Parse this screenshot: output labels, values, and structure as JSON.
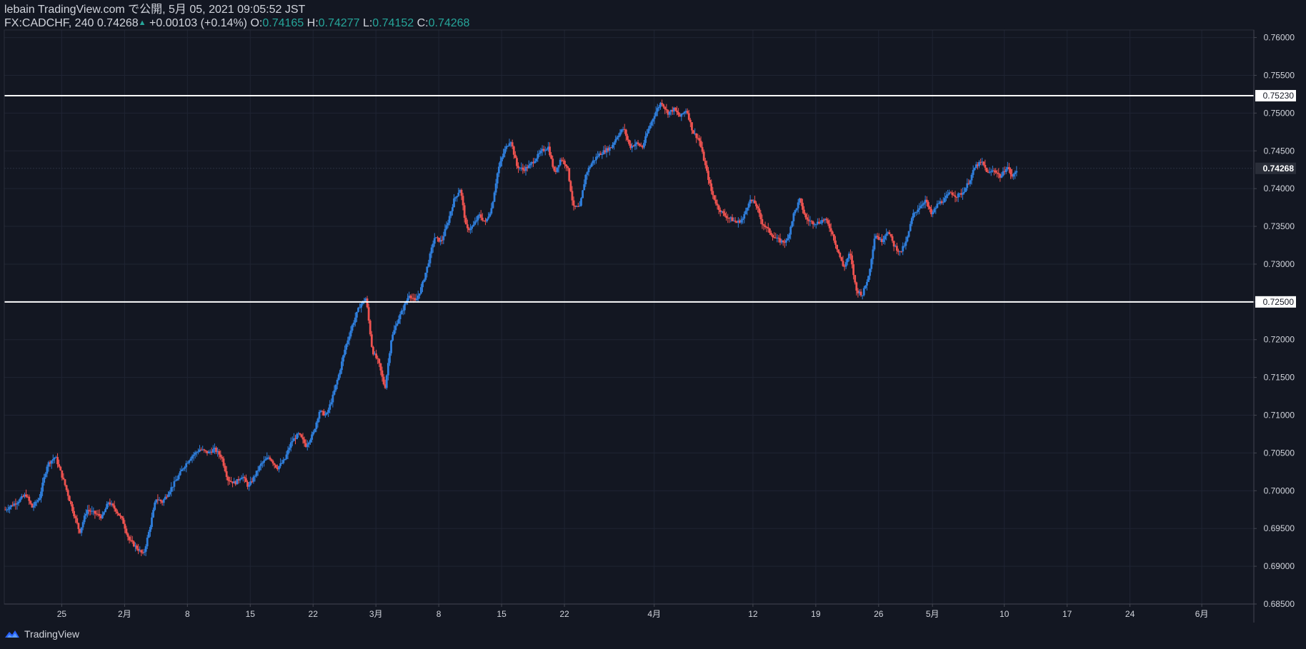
{
  "header": {
    "line1": "lebain TradingView.com で公開, 5月 05, 2021 09:05:52 JST",
    "symbol": "FX:CADCHF, 240",
    "last": "0.74268",
    "change": "+0.00103 (+0.14%)",
    "o_label": "O:",
    "o_value": "0.74165",
    "h_label": "H:",
    "h_value": "0.74277",
    "l_label": "L:",
    "l_value": "0.74152",
    "c_label": "C:",
    "c_value": "0.74268"
  },
  "footer": {
    "brand": "TradingView"
  },
  "colors": {
    "background": "#131722",
    "up": "#2f7fdd",
    "down": "#ef5350",
    "line": "#ffffff",
    "grid": "#1f2433",
    "text": "#d1d4dc"
  },
  "chart_data": {
    "type": "candlestick",
    "title": "",
    "y_axis": {
      "min": 0.685,
      "max": 0.761,
      "ticks": [
        "0.76000",
        "0.75500",
        "0.75000",
        "0.74500",
        "0.74000",
        "0.73500",
        "0.73000",
        "0.72500",
        "0.72000",
        "0.71500",
        "0.71000",
        "0.70500",
        "0.70000",
        "0.69500",
        "0.69000",
        "0.68500"
      ]
    },
    "x_axis": {
      "ticks": [
        {
          "label": "25",
          "day": 0
        },
        {
          "label": "2月",
          "day": 7
        },
        {
          "label": "8",
          "day": 14
        },
        {
          "label": "15",
          "day": 21
        },
        {
          "label": "22",
          "day": 28
        },
        {
          "label": "3月",
          "day": 35
        },
        {
          "label": "8",
          "day": 42
        },
        {
          "label": "15",
          "day": 49
        },
        {
          "label": "22",
          "day": 56
        },
        {
          "label": "4月",
          "day": 66
        },
        {
          "label": "12",
          "day": 77
        },
        {
          "label": "19",
          "day": 84
        },
        {
          "label": "26",
          "day": 91
        },
        {
          "label": "5月",
          "day": 97
        },
        {
          "label": "10",
          "day": 105
        },
        {
          "label": "17",
          "day": 112
        },
        {
          "label": "24",
          "day": 119
        },
        {
          "label": "6月",
          "day": 127
        }
      ],
      "day_range": [
        -6.4,
        132.8
      ]
    },
    "horizontal_lines": [
      {
        "price": 0.7523,
        "label": "0.75230"
      },
      {
        "price": 0.725,
        "label": "0.72500"
      }
    ],
    "last_price": {
      "price": 0.74268,
      "label": "0.74268"
    },
    "close_path": [
      [
        -6.3,
        0.6975
      ],
      [
        -5.0,
        0.6985
      ],
      [
        -4.0,
        0.6995
      ],
      [
        -3.3,
        0.6978
      ],
      [
        -2.5,
        0.699
      ],
      [
        -1.6,
        0.7035
      ],
      [
        -0.7,
        0.7045
      ],
      [
        0.3,
        0.701
      ],
      [
        1.2,
        0.6975
      ],
      [
        2.0,
        0.6945
      ],
      [
        2.8,
        0.6975
      ],
      [
        3.7,
        0.697
      ],
      [
        4.5,
        0.6965
      ],
      [
        5.2,
        0.6985
      ],
      [
        6.0,
        0.6975
      ],
      [
        6.8,
        0.696
      ],
      [
        7.5,
        0.6935
      ],
      [
        8.3,
        0.6925
      ],
      [
        9.1,
        0.6915
      ],
      [
        9.8,
        0.695
      ],
      [
        10.5,
        0.699
      ],
      [
        11.2,
        0.6985
      ],
      [
        12.0,
        0.7
      ],
      [
        12.8,
        0.7015
      ],
      [
        13.5,
        0.703
      ],
      [
        14.4,
        0.7045
      ],
      [
        15.4,
        0.7055
      ],
      [
        16.3,
        0.705
      ],
      [
        17.0,
        0.7055
      ],
      [
        17.8,
        0.7045
      ],
      [
        18.5,
        0.7015
      ],
      [
        19.3,
        0.701
      ],
      [
        20.1,
        0.702
      ],
      [
        20.8,
        0.7005
      ],
      [
        21.5,
        0.702
      ],
      [
        22.2,
        0.7035
      ],
      [
        23.1,
        0.7045
      ],
      [
        24.0,
        0.703
      ],
      [
        24.8,
        0.704
      ],
      [
        25.6,
        0.7065
      ],
      [
        26.4,
        0.7075
      ],
      [
        27.2,
        0.706
      ],
      [
        28.0,
        0.7075
      ],
      [
        28.7,
        0.7105
      ],
      [
        29.5,
        0.71
      ],
      [
        30.2,
        0.7125
      ],
      [
        30.9,
        0.7155
      ],
      [
        31.6,
        0.719
      ],
      [
        32.4,
        0.722
      ],
      [
        33.2,
        0.7245
      ],
      [
        33.9,
        0.7255
      ],
      [
        34.6,
        0.7185
      ],
      [
        35.3,
        0.717
      ],
      [
        36.0,
        0.7135
      ],
      [
        36.7,
        0.72
      ],
      [
        37.4,
        0.7225
      ],
      [
        38.0,
        0.724
      ],
      [
        38.7,
        0.726
      ],
      [
        39.4,
        0.725
      ],
      [
        40.1,
        0.727
      ],
      [
        40.8,
        0.73
      ],
      [
        41.5,
        0.7335
      ],
      [
        42.3,
        0.733
      ],
      [
        43.0,
        0.7355
      ],
      [
        43.7,
        0.7385
      ],
      [
        44.4,
        0.74
      ],
      [
        45.1,
        0.7345
      ],
      [
        45.8,
        0.735
      ],
      [
        46.5,
        0.7365
      ],
      [
        47.2,
        0.7355
      ],
      [
        47.9,
        0.7375
      ],
      [
        48.6,
        0.7425
      ],
      [
        49.3,
        0.745
      ],
      [
        50.0,
        0.7465
      ],
      [
        50.7,
        0.743
      ],
      [
        51.4,
        0.7425
      ],
      [
        52.1,
        0.743
      ],
      [
        52.8,
        0.744
      ],
      [
        53.5,
        0.745
      ],
      [
        54.2,
        0.7455
      ],
      [
        54.9,
        0.742
      ],
      [
        55.6,
        0.744
      ],
      [
        56.3,
        0.743
      ],
      [
        57.0,
        0.7375
      ],
      [
        57.7,
        0.7375
      ],
      [
        58.4,
        0.742
      ],
      [
        59.1,
        0.7435
      ],
      [
        59.8,
        0.7445
      ],
      [
        60.5,
        0.745
      ],
      [
        61.2,
        0.7455
      ],
      [
        61.9,
        0.747
      ],
      [
        62.6,
        0.748
      ],
      [
        63.3,
        0.7455
      ],
      [
        64.0,
        0.746
      ],
      [
        64.7,
        0.7455
      ],
      [
        65.4,
        0.748
      ],
      [
        66.1,
        0.75
      ],
      [
        66.8,
        0.7515
      ],
      [
        67.5,
        0.75
      ],
      [
        68.2,
        0.7505
      ],
      [
        68.9,
        0.7495
      ],
      [
        69.6,
        0.7505
      ],
      [
        70.3,
        0.7475
      ],
      [
        71.0,
        0.7465
      ],
      [
        71.7,
        0.743
      ],
      [
        72.4,
        0.7395
      ],
      [
        73.1,
        0.7375
      ],
      [
        73.8,
        0.7365
      ],
      [
        74.5,
        0.736
      ],
      [
        75.2,
        0.7355
      ],
      [
        75.9,
        0.736
      ],
      [
        76.6,
        0.7385
      ],
      [
        77.3,
        0.738
      ],
      [
        78.0,
        0.7355
      ],
      [
        78.7,
        0.7345
      ],
      [
        79.4,
        0.7335
      ],
      [
        80.1,
        0.733
      ],
      [
        80.8,
        0.733
      ],
      [
        81.5,
        0.7365
      ],
      [
        82.2,
        0.7385
      ],
      [
        82.9,
        0.736
      ],
      [
        83.6,
        0.7355
      ],
      [
        84.3,
        0.7355
      ],
      [
        85.0,
        0.736
      ],
      [
        85.7,
        0.7345
      ],
      [
        86.4,
        0.732
      ],
      [
        87.1,
        0.7295
      ],
      [
        87.8,
        0.7315
      ],
      [
        88.5,
        0.7265
      ],
      [
        89.2,
        0.726
      ],
      [
        89.9,
        0.7285
      ],
      [
        90.6,
        0.734
      ],
      [
        91.3,
        0.733
      ],
      [
        92.0,
        0.7345
      ],
      [
        92.7,
        0.7325
      ],
      [
        93.4,
        0.7315
      ],
      [
        94.1,
        0.733
      ],
      [
        94.8,
        0.7365
      ],
      [
        95.5,
        0.7375
      ],
      [
        96.2,
        0.7385
      ],
      [
        96.9,
        0.7365
      ],
      [
        97.6,
        0.738
      ],
      [
        98.3,
        0.7385
      ],
      [
        99.0,
        0.7395
      ],
      [
        99.7,
        0.739
      ],
      [
        100.4,
        0.7395
      ],
      [
        101.1,
        0.741
      ],
      [
        101.8,
        0.743
      ],
      [
        102.5,
        0.7435
      ],
      [
        103.2,
        0.742
      ],
      [
        103.9,
        0.7425
      ],
      [
        104.6,
        0.7415
      ],
      [
        105.3,
        0.743
      ],
      [
        105.9,
        0.7415
      ],
      [
        106.5,
        0.7427
      ]
    ]
  }
}
